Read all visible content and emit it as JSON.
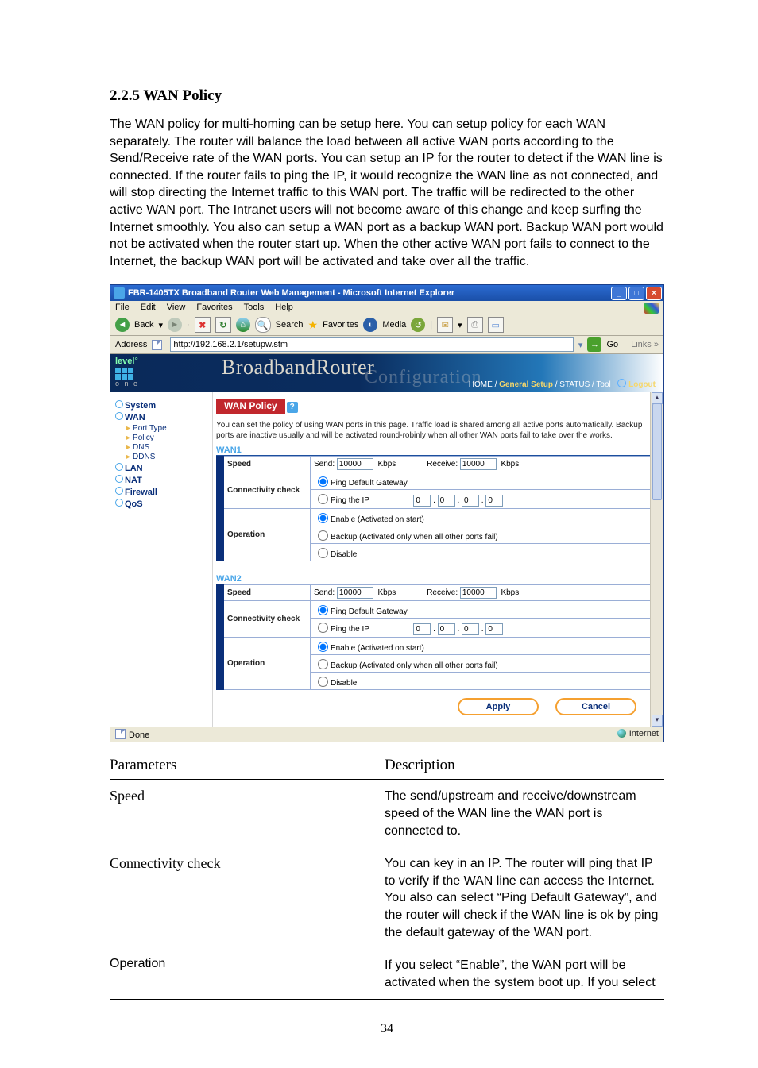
{
  "doc": {
    "heading": "2.2.5 WAN Policy",
    "body": "The WAN policy for multi-homing can be setup here. You can setup policy for each WAN separately. The router will balance the load between all active WAN ports according to the Send/Receive rate of the WAN ports. You can setup an IP for the router to detect if the WAN line is connected. If the router fails to ping the IP, it would recognize the WAN line as not connected, and will stop directing the Internet traffic to this WAN port. The traffic will be redirected to the other active WAN port. The Intranet users will not become aware of this change and keep surfing the Internet smoothly. You also can setup a WAN port as a backup WAN port. Backup WAN port would not be activated when the router start up. When the other active WAN port fails to connect to the Internet, the backup WAN port will be activated and take over all the traffic.",
    "page_number": "34"
  },
  "ie": {
    "title": "FBR-1405TX Broadband Router Web Management - Microsoft Internet Explorer",
    "menus": [
      "File",
      "Edit",
      "View",
      "Favorites",
      "Tools",
      "Help"
    ],
    "toolbar": {
      "back": "Back",
      "search": "Search",
      "favorites": "Favorites",
      "media": "Media"
    },
    "address_label": "Address",
    "address_value": "http://192.168.2.1/setupw.stm",
    "go": "Go",
    "links": "Links",
    "status_left": "Done",
    "status_right": "Internet"
  },
  "router": {
    "brand": "BroadbandRouter",
    "ghost": "Configuration",
    "logo_top": "level",
    "logo_bottom": "o n e",
    "crumbs": {
      "home": "HOME",
      "sep": " / ",
      "gs": "General Setup",
      "st": "STATUS",
      "tool": "Tool",
      "logout": "Logout"
    },
    "sidebar": {
      "top": [
        "System",
        "WAN"
      ],
      "wan_sub": [
        "Port Type",
        "Policy",
        "DNS",
        "DDNS"
      ],
      "rest": [
        "LAN",
        "NAT",
        "Firewall",
        "QoS"
      ]
    },
    "section_title": "WAN Policy",
    "description": "You can set the policy of using WAN ports in this page. Traffic load is shared among all active ports automatically. Backup ports are inactive usually and will be activated round-robinly when all other WAN ports fail to take over the works.",
    "labels": {
      "speed": "Speed",
      "conn": "Connectivity check",
      "op": "Operation",
      "send": "Send:",
      "recv": "Receive:",
      "kbps": "Kbps",
      "ping_gw": "Ping Default Gateway",
      "ping_ip": "Ping the IP",
      "enable": "Enable (Activated on start)",
      "backup": "Backup (Activated only when all other ports fail)",
      "disable": "Disable"
    },
    "wan": [
      {
        "name": "WAN1",
        "send": "10000",
        "recv": "10000",
        "ip": [
          "0",
          "0",
          "0",
          "0"
        ]
      },
      {
        "name": "WAN2",
        "send": "10000",
        "recv": "10000",
        "ip": [
          "0",
          "0",
          "0",
          "0"
        ]
      }
    ],
    "buttons": {
      "apply": "Apply",
      "cancel": "Cancel"
    }
  },
  "params": {
    "h1": "Parameters",
    "h2": "Description",
    "rows": [
      {
        "k": "Speed",
        "v": "The send/upstream and receive/downstream speed of the WAN line the WAN port is connected to."
      },
      {
        "k": "Connectivity check",
        "v": "You can key in an IP. The router will ping that IP to verify if the WAN line can access the Internet. You also can select “Ping Default Gateway”, and the router will check if the WAN line is ok by ping the default gateway of the WAN port."
      },
      {
        "k": "Operation",
        "v": "If you select “Enable”, the WAN port will be activated when the system boot up. If you select"
      }
    ]
  }
}
